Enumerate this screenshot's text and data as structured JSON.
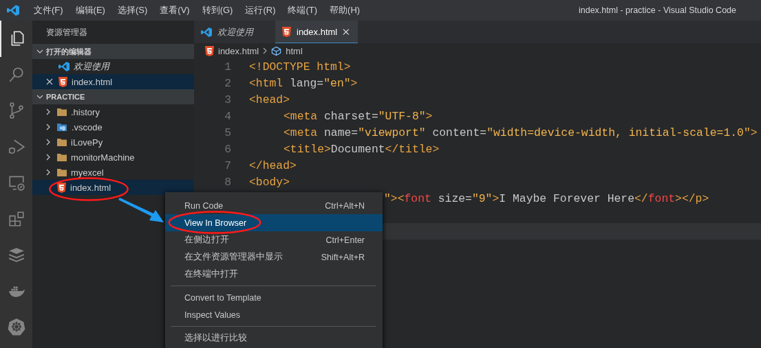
{
  "window": {
    "title": "index.html - practice - Visual Studio Code"
  },
  "menu_bar": [
    "文件(F)",
    "编辑(E)",
    "选择(S)",
    "查看(V)",
    "转到(G)",
    "运行(R)",
    "终端(T)",
    "帮助(H)"
  ],
  "activity_bar": [
    {
      "kind": "files",
      "selected": true
    },
    {
      "kind": "search",
      "selected": false
    },
    {
      "kind": "source-control",
      "selected": false
    },
    {
      "kind": "debug",
      "selected": false
    },
    {
      "kind": "remote",
      "selected": false
    },
    {
      "kind": "extensions",
      "selected": false
    },
    {
      "kind": "stack",
      "selected": false
    },
    {
      "kind": "docker",
      "selected": false
    },
    {
      "kind": "helm",
      "selected": false
    }
  ],
  "sidebar": {
    "title": "资源管理器",
    "open_editors": {
      "label": "打开的编辑器",
      "expanded": true,
      "items": [
        {
          "label": "欢迎使用",
          "kind": "vscode",
          "italic": true,
          "selected": false
        },
        {
          "label": "index.html",
          "kind": "html",
          "italic": false,
          "selected": true
        }
      ]
    },
    "folder": {
      "label": "PRACTICE",
      "expanded": true,
      "items": [
        {
          "label": ".history",
          "kind": "folder",
          "expanded": false,
          "selected": false
        },
        {
          "label": ".vscode",
          "kind": "vscode-folder",
          "expanded": false,
          "selected": false
        },
        {
          "label": "iLovePy",
          "kind": "folder",
          "expanded": false,
          "selected": false
        },
        {
          "label": "monitorMachine",
          "kind": "folder",
          "expanded": false,
          "selected": false
        },
        {
          "label": "myexcel",
          "kind": "folder",
          "expanded": false,
          "selected": false
        },
        {
          "label": "index.html",
          "kind": "html",
          "selected": true
        }
      ]
    }
  },
  "tabs": [
    {
      "label": "欢迎使用",
      "kind": "vscode",
      "selected": false
    },
    {
      "label": "index.html",
      "kind": "html",
      "selected": true
    }
  ],
  "breadcrumbs": [
    {
      "label": "index.html",
      "kind": "html"
    },
    {
      "label": "html",
      "kind": "element"
    }
  ],
  "editor": {
    "current_line_highlight": true,
    "lines": [
      {
        "number": "1",
        "kind": "full",
        "indented": false,
        "tokens": [
          {
            "t": "<!DOCTYPE html>",
            "color": "#e8a441"
          }
        ]
      },
      {
        "number": "2",
        "kind": "full",
        "indented": false,
        "tokens": [
          {
            "t": "<html",
            "color": "#e8a441"
          },
          {
            "t": " lang=",
            "color": "#c8c8c8"
          },
          {
            "t": "\"en\"",
            "color": "#f1b44c"
          },
          {
            "t": ">",
            "color": "#e8a441"
          }
        ]
      },
      {
        "number": "3",
        "kind": "full",
        "indented": false,
        "tokens": [
          {
            "t": "<head>",
            "color": "#e8a441"
          }
        ]
      },
      {
        "number": "4",
        "kind": "full",
        "indented": true,
        "tokens": [
          {
            "t": "<meta",
            "color": "#e8a441"
          },
          {
            "t": " charset=",
            "color": "#c8c8c8"
          },
          {
            "t": "\"UTF-8\"",
            "color": "#f1b44c"
          },
          {
            "t": ">",
            "color": "#e8a441"
          }
        ]
      },
      {
        "number": "5",
        "kind": "full",
        "indented": true,
        "tokens": [
          {
            "t": "<meta",
            "color": "#e8a441"
          },
          {
            "t": " name=",
            "color": "#c8c8c8"
          },
          {
            "t": "\"viewport\"",
            "color": "#f1b44c"
          },
          {
            "t": " content=",
            "color": "#c8c8c8"
          },
          {
            "t": "\"width=device-width, initial-scale=1.0\"",
            "color": "#f1b44c"
          },
          {
            "t": ">",
            "color": "#e8a441"
          }
        ]
      },
      {
        "number": "6",
        "kind": "full",
        "indented": true,
        "tokens": [
          {
            "t": "<title>",
            "color": "#e8a441"
          },
          {
            "t": "Document",
            "color": "#c8c8c8"
          },
          {
            "t": "</title>",
            "color": "#e8a441"
          }
        ]
      },
      {
        "number": "7",
        "kind": "full",
        "indented": false,
        "tokens": [
          {
            "t": "</head>",
            "color": "#e8a441"
          }
        ]
      },
      {
        "number": "8",
        "kind": "full",
        "indented": false,
        "tokens": [
          {
            "t": "<body>",
            "color": "#e8a441"
          }
        ]
      },
      {
        "kind": "covered",
        "indented": true,
        "tokens": [
          {
            "t": "\"",
            "color": "#f1b44c"
          },
          {
            "t": ">",
            "color": "#e8a441"
          },
          {
            "t": "<",
            "color": "#e8a441"
          },
          {
            "t": "font",
            "color": "#f44747"
          },
          {
            "t": " size=",
            "color": "#c8c8c8"
          },
          {
            "t": "\"9\"",
            "color": "#f1b44c"
          },
          {
            "t": ">",
            "color": "#e8a441"
          },
          {
            "t": "I Maybe Forever Here",
            "color": "#c8c8c8"
          },
          {
            "t": "</",
            "color": "#e8a441"
          },
          {
            "t": "font",
            "color": "#f44747"
          },
          {
            "t": ">",
            "color": "#e8a441"
          },
          {
            "t": "</p>",
            "color": "#e8a441"
          }
        ]
      }
    ]
  },
  "context_menu": {
    "groups": [
      [
        {
          "label": "Run Code",
          "shortcut": "Ctrl+Alt+N",
          "selected": false
        },
        {
          "label": "View In Browser",
          "selected": true
        },
        {
          "label": "在侧边打开",
          "shortcut": "Ctrl+Enter",
          "selected": false
        },
        {
          "label": "在文件资源管理器中显示",
          "shortcut": "Shift+Alt+R",
          "selected": false
        },
        {
          "label": "在终端中打开",
          "selected": false
        }
      ],
      [
        {
          "label": "Convert to Template",
          "selected": false
        },
        {
          "label": "Inspect Values",
          "selected": false
        }
      ],
      [
        {
          "label": "选择以进行比较",
          "selected": false
        }
      ]
    ]
  },
  "annotations": [
    {
      "kind": "ellipse"
    },
    {
      "kind": "arrow"
    },
    {
      "kind": "ellipse"
    }
  ]
}
